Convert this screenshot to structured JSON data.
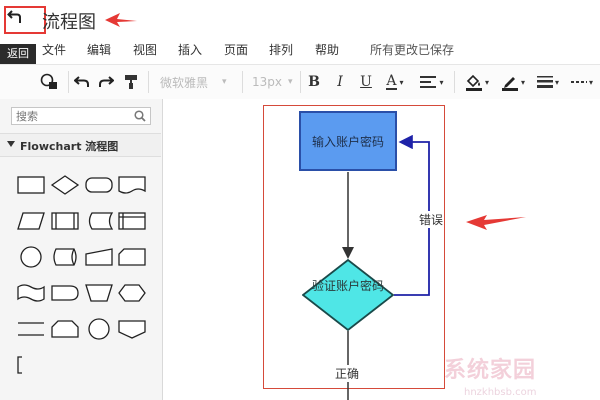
{
  "app": {
    "title": "流程图",
    "back_tooltip": "返回"
  },
  "menu": {
    "items": [
      "文件",
      "编辑",
      "视图",
      "插入",
      "页面",
      "排列",
      "帮助"
    ],
    "save_status": "所有更改已保存"
  },
  "toolbar": {
    "font_family": "微软雅黑",
    "font_size": "13px",
    "bold": "B",
    "italic": "I",
    "underline": "U",
    "font_color": "A"
  },
  "sidebar": {
    "search_placeholder": "搜索",
    "section_title": "Flowchart 流程图",
    "shapes": [
      "process",
      "decision",
      "terminator",
      "document",
      "data-io",
      "predefined-process",
      "stored-data",
      "internal-storage",
      "connector",
      "direct-data",
      "manual-input",
      "card",
      "punched-tape",
      "delay",
      "manual-operation",
      "preparation",
      "parallel-mode",
      "delay-alt",
      "or-connector",
      "off-page-connector",
      "annotation"
    ]
  },
  "canvas": {
    "node_input": "输入账户密码",
    "node_verify": "验证账户密码",
    "edge_error_label": "错误",
    "edge_ok_label": "正确"
  },
  "colors": {
    "process_fill": "#5b9bf0",
    "process_stroke": "#2a4fa8",
    "decision_fill": "#4fe6e6",
    "decision_stroke": "#1a4a4a",
    "loop_edge": "#1e22a8",
    "page_outline": "#d54a3a",
    "annotation_red": "#e53935"
  },
  "watermark": {
    "text": "系统家园",
    "sub": "hnzkhbsb.com"
  }
}
